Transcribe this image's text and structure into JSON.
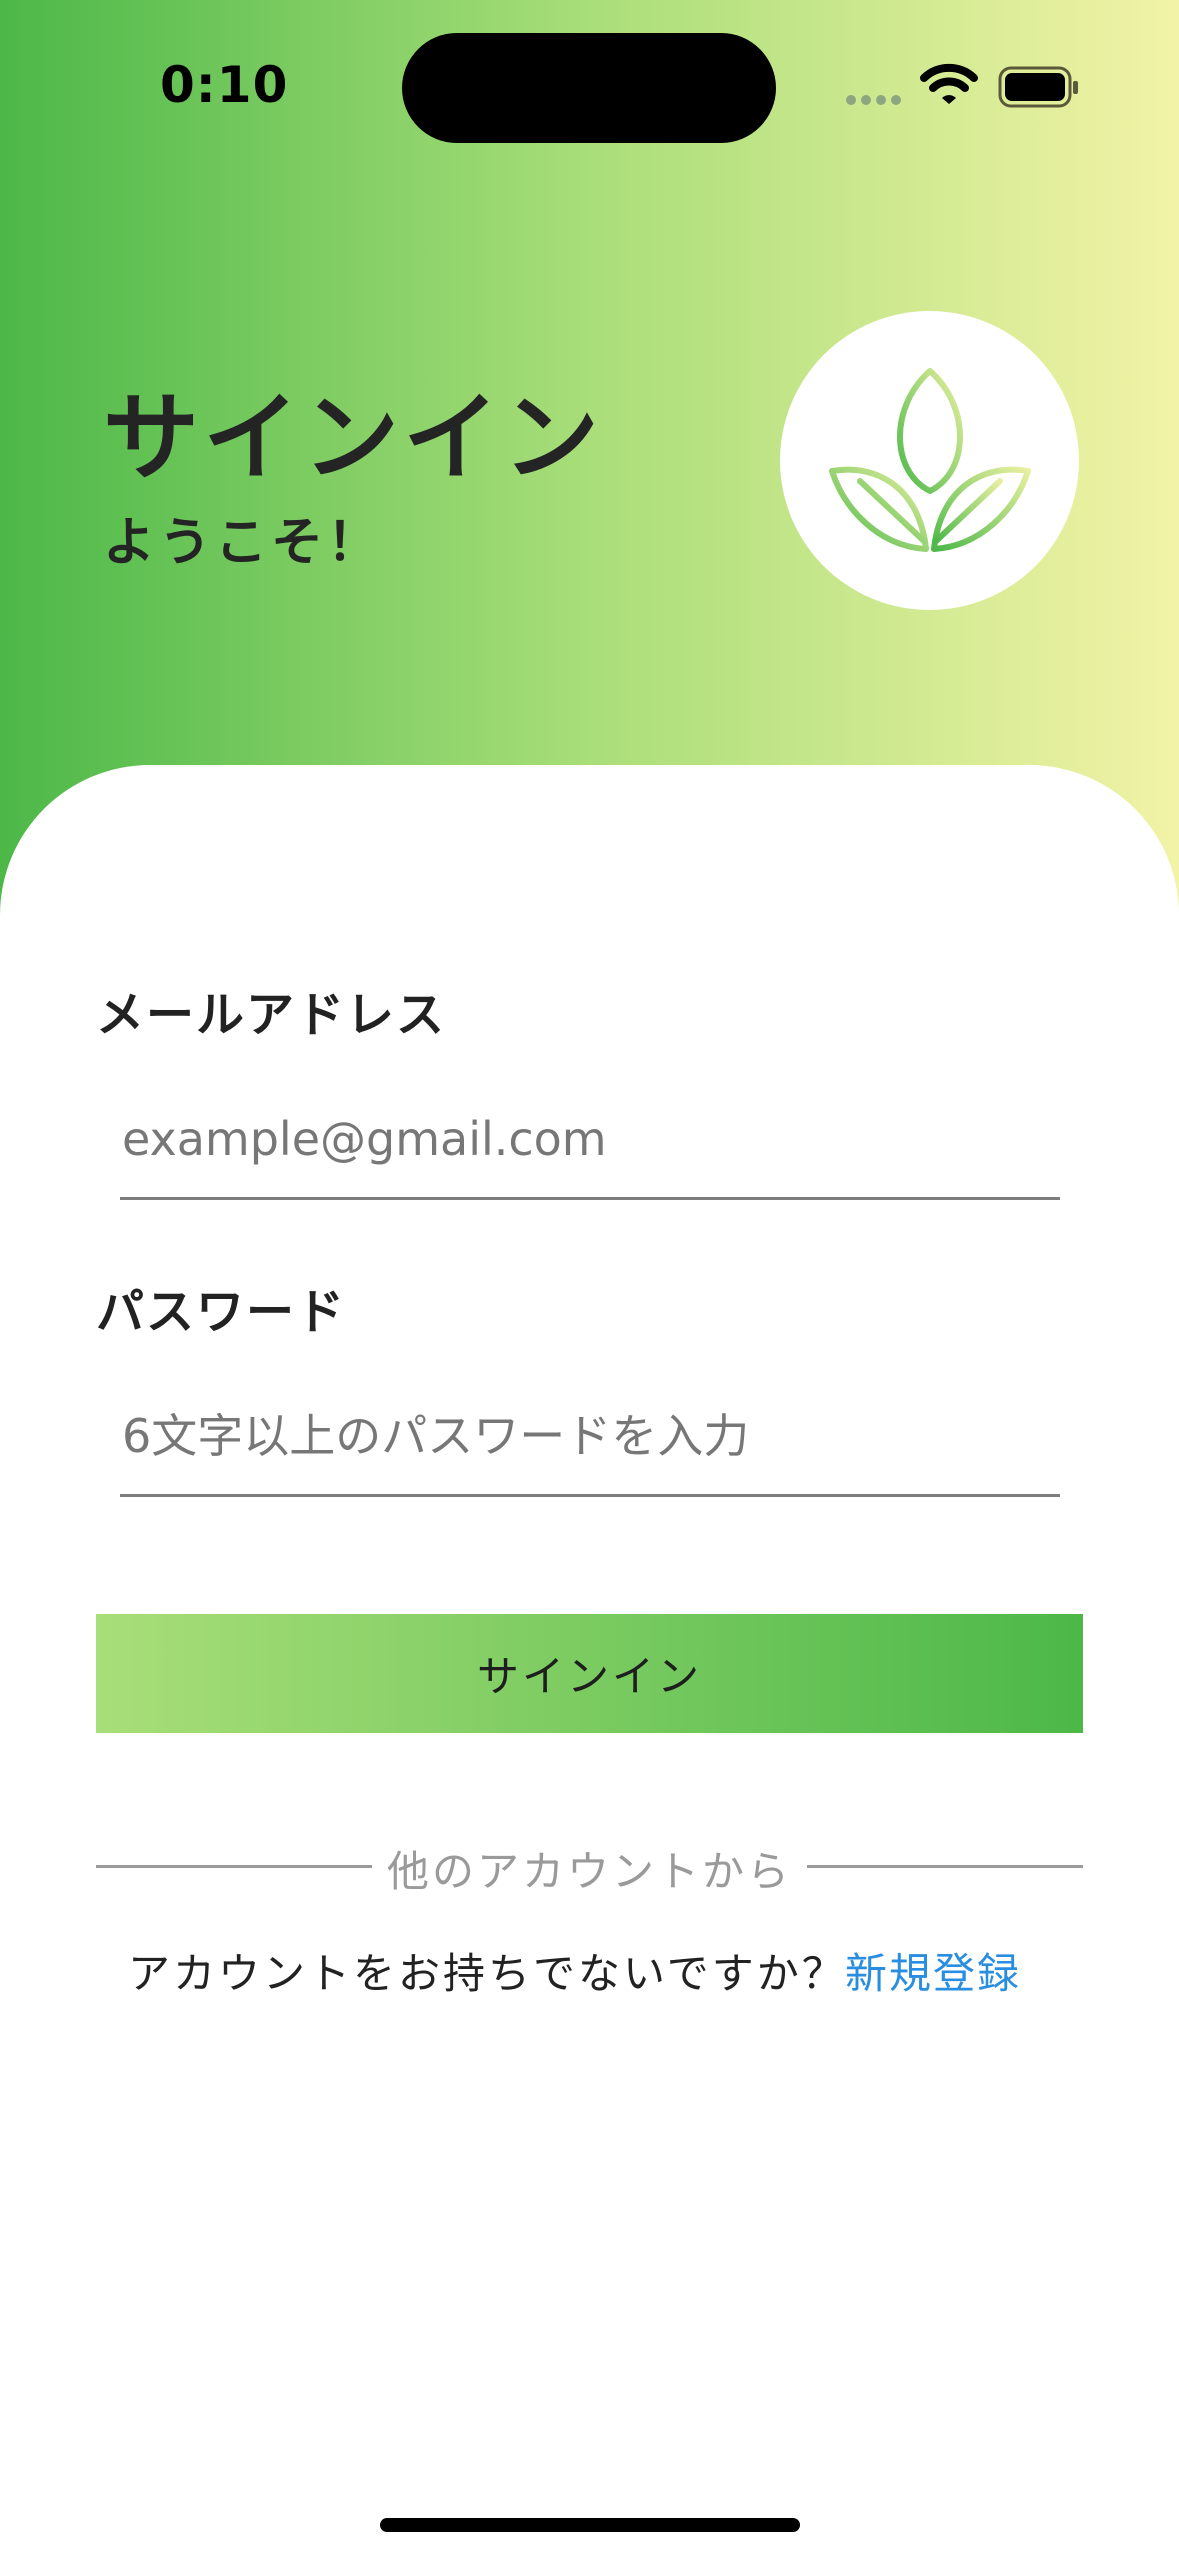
{
  "status_bar": {
    "time": "0:10",
    "icons": [
      "cellular-signal-icon",
      "wifi-icon",
      "battery-icon"
    ]
  },
  "header": {
    "title": "サインイン",
    "subtitle": "ようこそ！",
    "logo_icon": "leaf-sprout-icon"
  },
  "form": {
    "email": {
      "label": "メールアドレス",
      "placeholder": "example@gmail.com",
      "value": ""
    },
    "password": {
      "label": "パスワード",
      "placeholder": "6文字以上のパスワードを入力",
      "value": ""
    },
    "submit_label": "サインイン"
  },
  "divider": {
    "text": "他のアカウントから"
  },
  "footer": {
    "prompt": "アカウントをお持ちでないですか？",
    "register_label": "新規登録"
  },
  "colors": {
    "gradient_start": "#4cb848",
    "gradient_mid": "#a9de79",
    "gradient_end": "#f2f3a6",
    "link": "#2a8ee0"
  }
}
